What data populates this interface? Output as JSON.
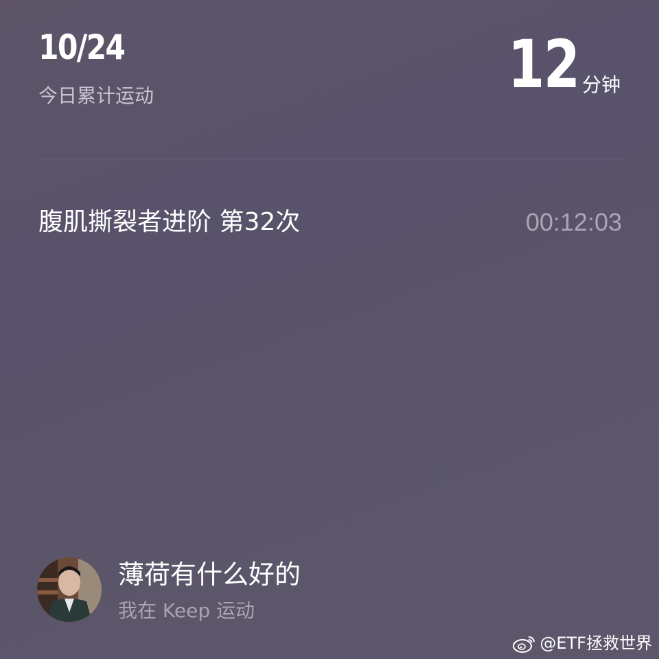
{
  "header": {
    "date": "10/24",
    "subtitle": "今日累计运动",
    "total_minutes": "12",
    "minutes_unit": "分钟"
  },
  "activity": {
    "name": "腹肌撕裂者进阶 第32次",
    "duration": "00:12:03"
  },
  "user": {
    "name": "薄荷有什么好的",
    "subtitle": "我在 Keep 运动"
  },
  "watermark": {
    "text": "@ETF拯救世界",
    "icon": "weibo-icon"
  },
  "colors": {
    "background": "#5a5569",
    "secondary_text": "#c9c4d0",
    "duration_text": "#aaa4b4"
  }
}
